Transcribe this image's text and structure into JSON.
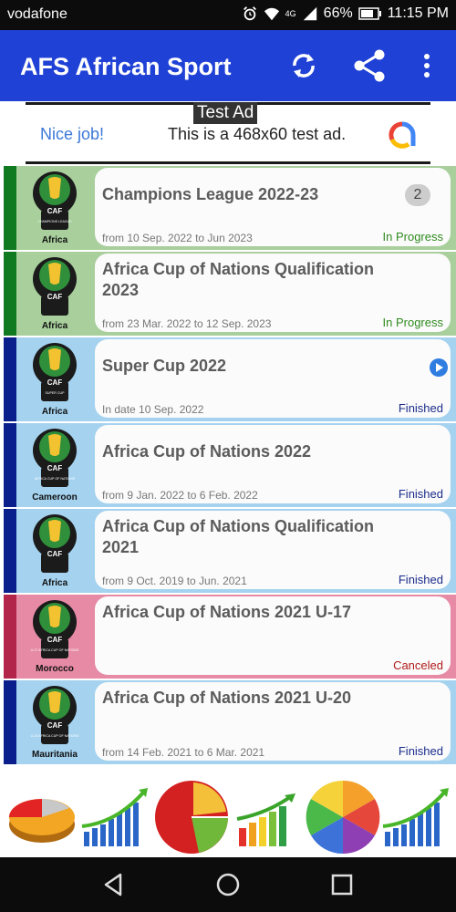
{
  "status_bar": {
    "carrier": "vodafone",
    "signal_label": "4G",
    "battery": "66%",
    "time": "11:15 PM"
  },
  "app_bar": {
    "title": "AFS African Sport",
    "icons": [
      "refresh-icon",
      "share-icon",
      "more-vert-icon"
    ]
  },
  "ad": {
    "tag": "Test Ad",
    "headline": "Nice job!",
    "text": "This is a 468x60 test ad."
  },
  "competitions": [
    {
      "name": "Champions League 2022-23",
      "dates": "from 10 Sep. 2022 to Jun 2023",
      "status": "In Progress",
      "country": "Africa",
      "badge": "2",
      "logo_text": "CAF",
      "logo_sub": "CHAMPIONS LEAGUE",
      "stripe": "#0f7a1f",
      "bg": "#a8cf9c",
      "status_color": "#2f8a1f"
    },
    {
      "name": "Africa Cup of Nations Qualification 2023",
      "dates": "from 23 Mar. 2022 to 12 Sep. 2023",
      "status": "In Progress",
      "country": "Africa",
      "badge": "",
      "logo_text": "CAF",
      "logo_sub": "",
      "stripe": "#0f7a1f",
      "bg": "#a8cf9c",
      "status_color": "#2f8a1f"
    },
    {
      "name": "Super Cup 2022",
      "dates": "In date 10 Sep. 2022",
      "status": "Finished",
      "country": "Africa",
      "badge": "",
      "logo_text": "CAF",
      "logo_sub": "SUPER CUP",
      "stripe": "#0a1e8c",
      "bg": "#a4d2ef",
      "status_color": "#1a2c8a"
    },
    {
      "name": "Africa Cup of Nations 2022",
      "dates": "from 9 Jan. 2022 to 6 Feb. 2022",
      "status": "Finished",
      "country": "Cameroon",
      "badge": "",
      "logo_text": "CAF",
      "logo_sub": "AFRICA CUP OF NATIONS",
      "stripe": "#0a1e8c",
      "bg": "#a4d2ef",
      "status_color": "#1a2c8a"
    },
    {
      "name": "Africa Cup of Nations Qualification 2021",
      "dates": "from 9 Oct. 2019 to Jun. 2021",
      "status": "Finished",
      "country": "Africa",
      "badge": "",
      "logo_text": "CAF",
      "logo_sub": "",
      "stripe": "#0a1e8c",
      "bg": "#a4d2ef",
      "status_color": "#1a2c8a"
    },
    {
      "name": "Africa Cup of Nations 2021 U-17",
      "dates": "",
      "status": "Canceled",
      "country": "Morocco",
      "badge": "",
      "logo_text": "CAF",
      "logo_sub": "U-17 AFRICA CUP OF NATIONS",
      "stripe": "#b3244b",
      "bg": "#e68aa5",
      "status_color": "#b01a1a"
    },
    {
      "name": "Africa Cup of Nations 2021 U-20",
      "dates": "from 14 Feb. 2021 to 6 Mar. 2021",
      "status": "Finished",
      "country": "Mauritania",
      "badge": "",
      "logo_text": "CAF",
      "logo_sub": "U-20 AFRICA CUP OF NATIONS",
      "stripe": "#0a1e8c",
      "bg": "#a4d2ef",
      "status_color": "#1a2c8a"
    }
  ],
  "bottom_icons": [
    "pie-3d-chart-icon",
    "growth-bars-icon",
    "red-pie-icon",
    "bar-arrow-icon",
    "color-pie-icon",
    "growth-bars-icon"
  ],
  "nav_bar": {
    "buttons": [
      "back-icon",
      "home-icon",
      "recents-icon"
    ]
  }
}
